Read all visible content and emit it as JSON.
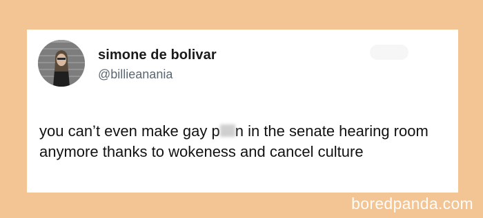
{
  "tweet": {
    "display_name": "simone de bolivar",
    "handle": "@billieanania",
    "text_before": "you can’t even make gay p",
    "text_after": "n in the senate hearing room anymore thanks to wokeness and cancel culture"
  },
  "watermark": "boredpanda.com"
}
